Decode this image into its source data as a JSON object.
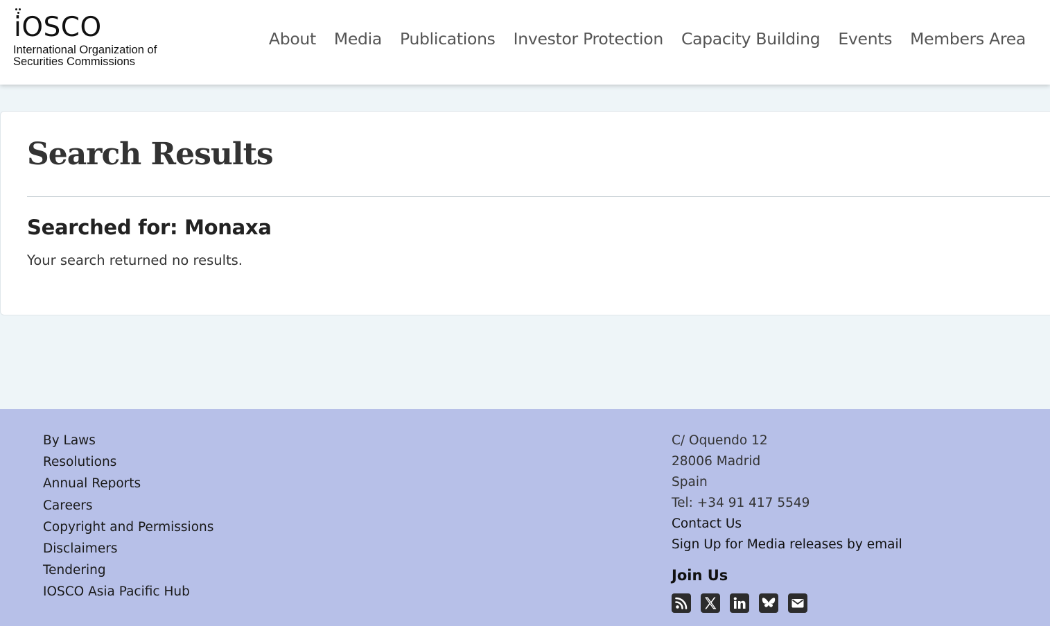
{
  "logo": {
    "wordmark": "iOSCO",
    "subtitle_line1": "International Organization of",
    "subtitle_line2": "Securities Commissions"
  },
  "nav": {
    "items": [
      {
        "label": "About"
      },
      {
        "label": "Media"
      },
      {
        "label": "Publications"
      },
      {
        "label": "Investor Protection"
      },
      {
        "label": "Capacity Building"
      },
      {
        "label": "Events"
      },
      {
        "label": "Members Area"
      }
    ]
  },
  "main": {
    "title": "Search Results",
    "searched_for": "Searched for: Monaxa",
    "no_results": "Your search returned no results."
  },
  "footer": {
    "links": [
      {
        "label": "By Laws"
      },
      {
        "label": "Resolutions"
      },
      {
        "label": "Annual Reports"
      },
      {
        "label": "Careers"
      },
      {
        "label": "Copyright and Permissions"
      },
      {
        "label": "Disclaimers"
      },
      {
        "label": "Tendering"
      },
      {
        "label": "IOSCO Asia Pacific Hub"
      }
    ],
    "address": {
      "street": "C/ Oquendo 12",
      "city": "28006 Madrid",
      "country": "Spain",
      "tel": "Tel: +34 91 417 5549"
    },
    "contact_link": "Contact Us",
    "signup_link": "Sign Up for Media releases by email",
    "join_title": "Join Us",
    "social_icons": [
      "rss-icon",
      "x-icon",
      "linkedin-icon",
      "bluesky-icon",
      "email-icon"
    ]
  },
  "colors": {
    "page_bg": "#eef5f8",
    "footer_bg": "#b7c0e8",
    "icon_bg": "#2c2c2c"
  }
}
